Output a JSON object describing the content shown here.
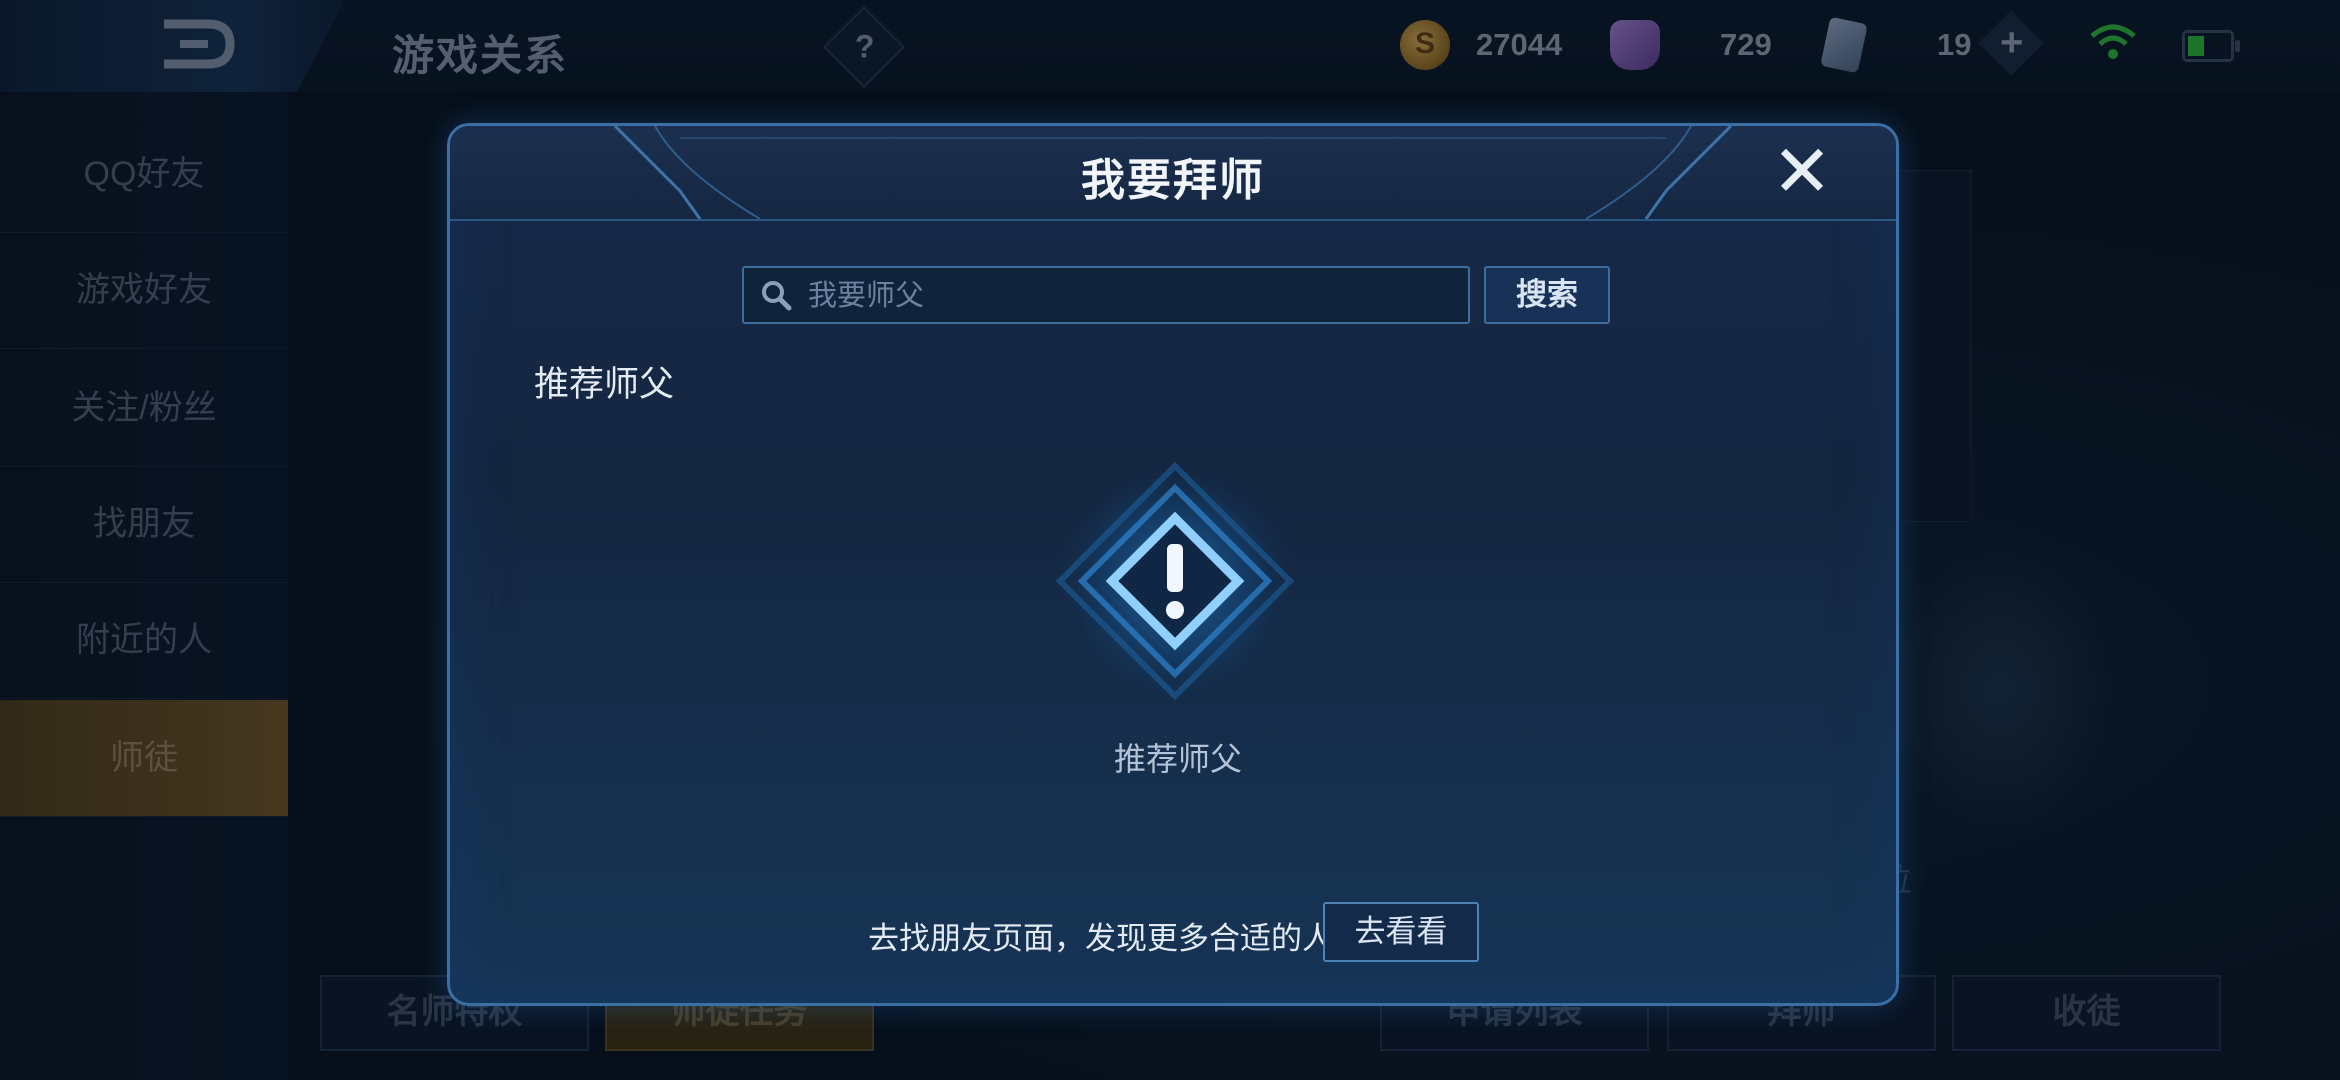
{
  "topbar": {
    "title": "游戏关系",
    "help": "?",
    "gold": "27044",
    "gems": "729",
    "cards": "19"
  },
  "sidebar": {
    "items": [
      {
        "label": "QQ好友"
      },
      {
        "label": "游戏好友"
      },
      {
        "label": "关注/粉丝"
      },
      {
        "label": "找朋友"
      },
      {
        "label": "附近的人"
      },
      {
        "label": "师徒"
      }
    ]
  },
  "bottom_tabs": [
    "名师特权",
    "师徒任务",
    "申请列表",
    "拜师",
    "收徒"
  ],
  "background": {
    "position_text": "位"
  },
  "modal": {
    "title": "我要拜师",
    "search": {
      "placeholder": "我要师父",
      "value": "",
      "button": "搜索"
    },
    "section_label": "推荐师父",
    "empty_text": "推荐师父",
    "hint_text": "去找朋友页面，发现更多合适的人",
    "go_button": "去看看"
  },
  "colors": {
    "accent": "#3c6fa3",
    "gold_tab": "#6b5226",
    "modal_bg": "#142640"
  },
  "icons": [
    "back-icon",
    "help-icon",
    "coin-icon",
    "gem-icon",
    "card-icon",
    "plus-icon",
    "wifi-icon",
    "battery-icon",
    "close-icon",
    "search-icon",
    "alert-icon"
  ]
}
